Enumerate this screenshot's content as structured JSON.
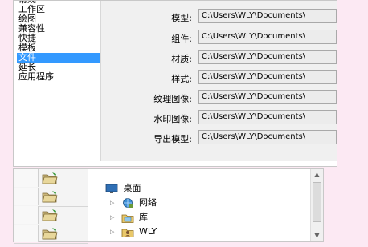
{
  "nav": {
    "items": [
      {
        "label": "常规",
        "selected": false
      },
      {
        "label": "工作区",
        "selected": false
      },
      {
        "label": "绘图",
        "selected": false
      },
      {
        "label": "兼容性",
        "selected": false
      },
      {
        "label": "快捷",
        "selected": false
      },
      {
        "label": "模板",
        "selected": false
      },
      {
        "label": "文件",
        "selected": true
      },
      {
        "label": "延长",
        "selected": false
      },
      {
        "label": "应用程序",
        "selected": false
      }
    ]
  },
  "paths": {
    "rows": [
      {
        "label": "模型:",
        "value": "C:\\Users\\WLY\\Documents\\"
      },
      {
        "label": "组件:",
        "value": "C:\\Users\\WLY\\Documents\\"
      },
      {
        "label": "材质:",
        "value": "C:\\Users\\WLY\\Documents\\"
      },
      {
        "label": "样式:",
        "value": "C:\\Users\\WLY\\Documents\\"
      },
      {
        "label": "纹理图像:",
        "value": "C:\\Users\\WLY\\Documents\\"
      },
      {
        "label": "水印图像:",
        "value": "C:\\Users\\WLY\\Documents\\"
      },
      {
        "label": "导出模型:",
        "value": "C:\\Users\\WLY\\Documents\\"
      }
    ]
  },
  "folder_tree": {
    "items": [
      {
        "label": "桌面",
        "icon": "desktop-icon"
      },
      {
        "label": "网络",
        "icon": "network-icon"
      },
      {
        "label": "库",
        "icon": "library-icon"
      },
      {
        "label": "WLY",
        "icon": "user-folder-icon"
      }
    ]
  },
  "colors": {
    "selection": "#3399ff",
    "frame": "#fce9f3",
    "field_bg": "#ececec"
  }
}
